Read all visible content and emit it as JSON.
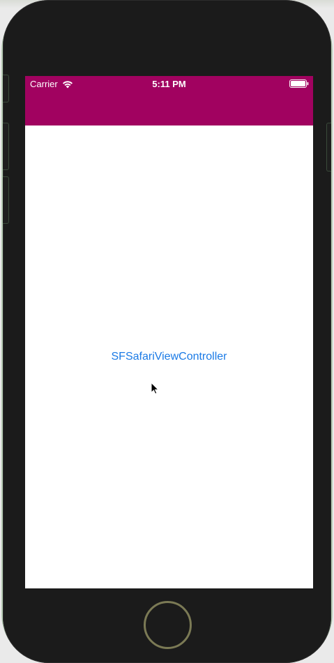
{
  "status_bar": {
    "carrier": "Carrier",
    "time": "5:11 PM",
    "wifi_icon": "wifi-icon",
    "battery_icon": "battery-full-icon"
  },
  "nav_bar": {
    "color": "#a10260"
  },
  "content": {
    "button_label": "SFSafariViewController",
    "button_color": "#1a7ae6"
  },
  "device": {
    "home_button_icon": "home-button"
  }
}
